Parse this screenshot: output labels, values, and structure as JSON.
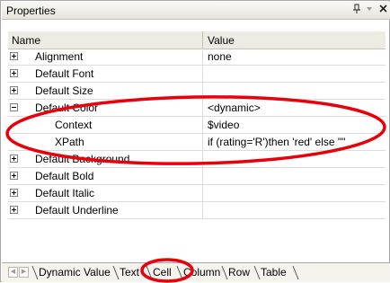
{
  "window": {
    "title": "Properties",
    "pin_glyph": "ᵾ",
    "dropdown_glyph": "▾",
    "close_glyph": "×"
  },
  "grid": {
    "header": {
      "name": "Name",
      "value": "Value"
    },
    "rows": [
      {
        "name": "Alignment",
        "value": "none",
        "expander": "plus",
        "child": false
      },
      {
        "name": "Default Font",
        "value": "",
        "expander": "plus",
        "child": false
      },
      {
        "name": "Default Size",
        "value": "",
        "expander": "plus",
        "child": false
      },
      {
        "name": "Default Color",
        "value": "<dynamic>",
        "expander": "minus",
        "child": false
      },
      {
        "name": "Context",
        "value": "$video",
        "expander": "",
        "child": true
      },
      {
        "name": "XPath",
        "value": "if (rating='R')then 'red' else \"\"",
        "expander": "",
        "child": true
      },
      {
        "name": "Default Background",
        "value": "",
        "expander": "plus",
        "child": false
      },
      {
        "name": "Default Bold",
        "value": "",
        "expander": "plus",
        "child": false
      },
      {
        "name": "Default Italic",
        "value": "",
        "expander": "plus",
        "child": false
      },
      {
        "name": "Default Underline",
        "value": "",
        "expander": "plus",
        "child": false
      }
    ]
  },
  "tabs": [
    "Dynamic Value",
    "Text",
    "Cell",
    "Column",
    "Row",
    "Table"
  ],
  "active_tab": "Text",
  "colors": {
    "annotation": "#e8000b",
    "header_bg": "#ecebe4"
  }
}
